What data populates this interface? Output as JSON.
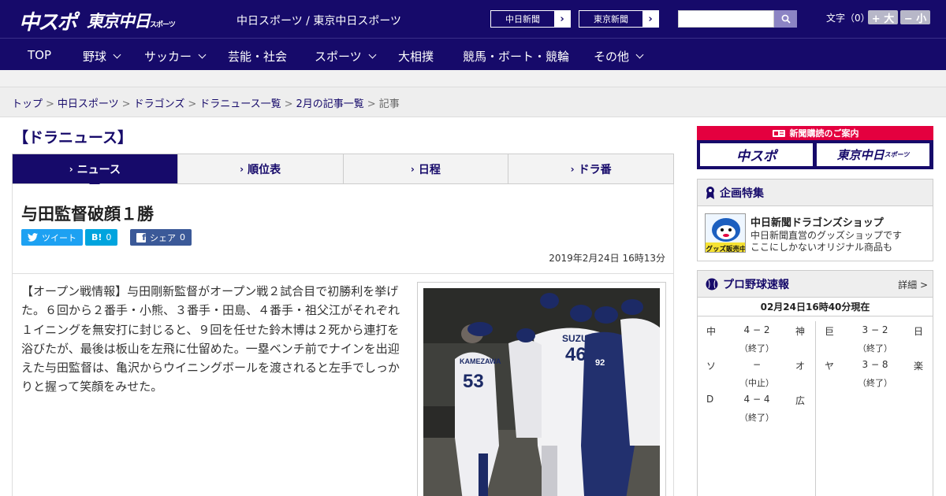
{
  "header": {
    "logo_main": "中スポ",
    "logo_tokyo": "東京中日",
    "logo_tokyo_small": "スポーツ",
    "tagline": "中日スポーツ / 東京中日スポーツ",
    "ext_links": [
      {
        "label": "中日新聞"
      },
      {
        "label": "東京新聞"
      }
    ],
    "search": {
      "value": "",
      "placeholder": ""
    },
    "font_size_label": "文字（0）",
    "font_larger": "+ 大",
    "font_smaller": "− 小"
  },
  "nav": {
    "items": [
      {
        "label": "TOP"
      },
      {
        "label": "野球"
      },
      {
        "label": "サッカー"
      },
      {
        "label": "芸能・社会"
      },
      {
        "label": "スポーツ"
      },
      {
        "label": "大相撲"
      },
      {
        "label": "競馬・ボート・競輪"
      },
      {
        "label": "その他"
      }
    ]
  },
  "breadcrumb": {
    "items": [
      "トップ",
      "中日スポーツ",
      "ドラゴンズ",
      "ドラニュース一覧",
      "2月の記事一覧"
    ],
    "current": "記事"
  },
  "section": {
    "title": "【ドラニュース】",
    "tabs": [
      {
        "label": "ニュース"
      },
      {
        "label": "順位表"
      },
      {
        "label": "日程"
      },
      {
        "label": "ドラ番"
      }
    ]
  },
  "article": {
    "headline": "与田監督破顔１勝",
    "share": {
      "tweet_label": "ツイート",
      "hatena_label": "B!",
      "hatena_count": "0",
      "facebook_label": "シェア",
      "facebook_count": "0"
    },
    "date": "2019年2月24日 16時13分",
    "body": "【オープン戦情報】与田剛新監督がオープン戦２試合目で初勝利を挙げた。６回から２番手・小熊、３番手・田島、４番手・祖父江がそれぞれ１イニングを無安打に封じると、９回を任せた鈴木博は２死から連打を浴びたが、最後は板山を左飛に仕留めた。一塁ベンチ前でナインを出迎えた与田監督は、亀沢からウイニングボールを渡されると左手でしっかりと握って笑顔をみせた。",
    "photo": {
      "jersey_left_name": "KAMEZAWA",
      "jersey_left_number": "53",
      "jersey_mid_name": "SUZUKI",
      "jersey_mid_number": "46",
      "jersey_right_number": "92"
    }
  },
  "sidebar": {
    "subscribe": {
      "head": "新聞購読のご案内",
      "btn_chuspo": "中スポ",
      "btn_tokyo": "東京中日",
      "btn_tokyo_small": "スポーツ"
    },
    "special": {
      "title": "企画特集",
      "item_title": "中日新聞ドラゴンズショップ",
      "item_desc_1": "中日新聞直営のグッズショップです",
      "item_desc_2": "ここにしかないオリジナル商品も",
      "thumb_caption": "グッズ販売中"
    },
    "scores": {
      "title": "プロ野球速報",
      "more": "詳細 >",
      "time": "02月24日16時40分現在",
      "left": [
        {
          "t1": "中",
          "score": "4 − 2",
          "t2": "神",
          "status": "（終了）"
        },
        {
          "t1": "ソ",
          "score": "−",
          "t2": "オ",
          "status": "（中止）"
        },
        {
          "t1": "D",
          "score": "4 − 4",
          "t2": "広",
          "status": "（終了）"
        }
      ],
      "right": [
        {
          "t1": "巨",
          "score": "3 − 2",
          "t2": "日",
          "status": "（終了）"
        },
        {
          "t1": "ヤ",
          "score": "3 − 8",
          "t2": "楽",
          "status": "（終了）"
        }
      ]
    }
  },
  "colors": {
    "brand_navy": "#160a6a",
    "subscribe_red": "#e4003f",
    "twitter": "#1da1f2",
    "hatena": "#00a4de",
    "facebook": "#3b5998"
  }
}
